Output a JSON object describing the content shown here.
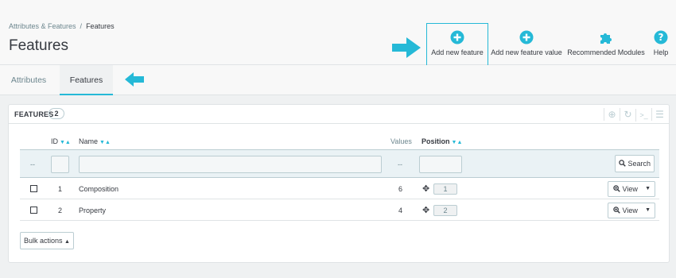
{
  "breadcrumb": {
    "parent": "Attributes & Features",
    "separator": "/",
    "current": "Features"
  },
  "page_title": "Features",
  "toolbar": {
    "add_feature": "Add new feature",
    "add_feature_value": "Add new feature value",
    "recommended_modules": "Recommended Modules",
    "help": "Help"
  },
  "tabs": [
    {
      "label": "Attributes",
      "active": false
    },
    {
      "label": "Features",
      "active": true
    }
  ],
  "panel": {
    "title": "FEATURES",
    "count": "2",
    "icons": [
      "add-icon",
      "refresh-icon",
      "sql-icon",
      "database-icon"
    ]
  },
  "table": {
    "headers": {
      "id": "ID",
      "name": "Name",
      "values": "Values",
      "position": "Position"
    },
    "filter": {
      "dash_left": "--",
      "dash_values": "--",
      "search": "Search"
    },
    "rows": [
      {
        "id": "1",
        "name": "Composition",
        "values": "6",
        "position": "1",
        "action": "View"
      },
      {
        "id": "2",
        "name": "Property",
        "values": "4",
        "position": "2",
        "action": "View"
      }
    ]
  },
  "bulk_actions": "Bulk actions",
  "colors": {
    "accent": "#25b9d7",
    "text": "#363a41",
    "muted": "#6c868e",
    "border": "#bbcdd2"
  }
}
